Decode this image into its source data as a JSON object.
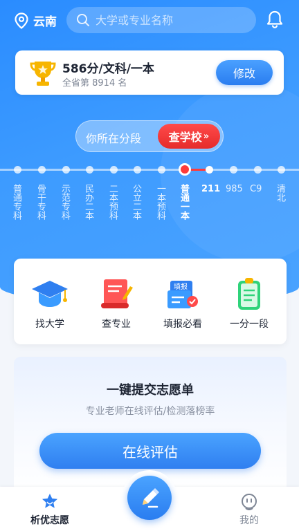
{
  "topbar": {
    "location": "云南",
    "search_placeholder": "大学或专业名称"
  },
  "score_card": {
    "score_line": "586分/文科/一本",
    "rank_line": "全省第 8914 名",
    "edit_label": "修改"
  },
  "segment": {
    "prompt": "你所在分段",
    "button_label": "查学校",
    "button_chevron": "»"
  },
  "categories": [
    {
      "label": "普通专科",
      "active": false
    },
    {
      "label": "骨干专科",
      "active": false
    },
    {
      "label": "示范专科",
      "active": false
    },
    {
      "label": "民办二本",
      "active": false
    },
    {
      "label": "二本预科",
      "active": false
    },
    {
      "label": "公立二本",
      "active": false
    },
    {
      "label": "一本预科",
      "active": false
    },
    {
      "label": "普通一本",
      "active": true
    },
    {
      "label": "211",
      "active": false
    },
    {
      "label": "985",
      "active": false
    },
    {
      "label": "C9",
      "active": false
    },
    {
      "label": "清北",
      "active": false
    }
  ],
  "features": [
    {
      "label": "找大学",
      "icon": "graduation-cap-icon"
    },
    {
      "label": "查专业",
      "icon": "scroll-icon"
    },
    {
      "label": "填报必看",
      "icon": "guide-book-icon",
      "badge": "填报"
    },
    {
      "label": "一分一段",
      "icon": "clipboard-icon"
    }
  ],
  "submit": {
    "title": "一键提交志愿单",
    "subtitle": "专业老师在线评估/检测落榜率",
    "button_label": "在线评估"
  },
  "nav": {
    "home_label": "析优志愿",
    "mine_label": "我的"
  },
  "colors": {
    "brand_blue": "#2f7ff0",
    "accent_red": "#ff3b3b"
  }
}
